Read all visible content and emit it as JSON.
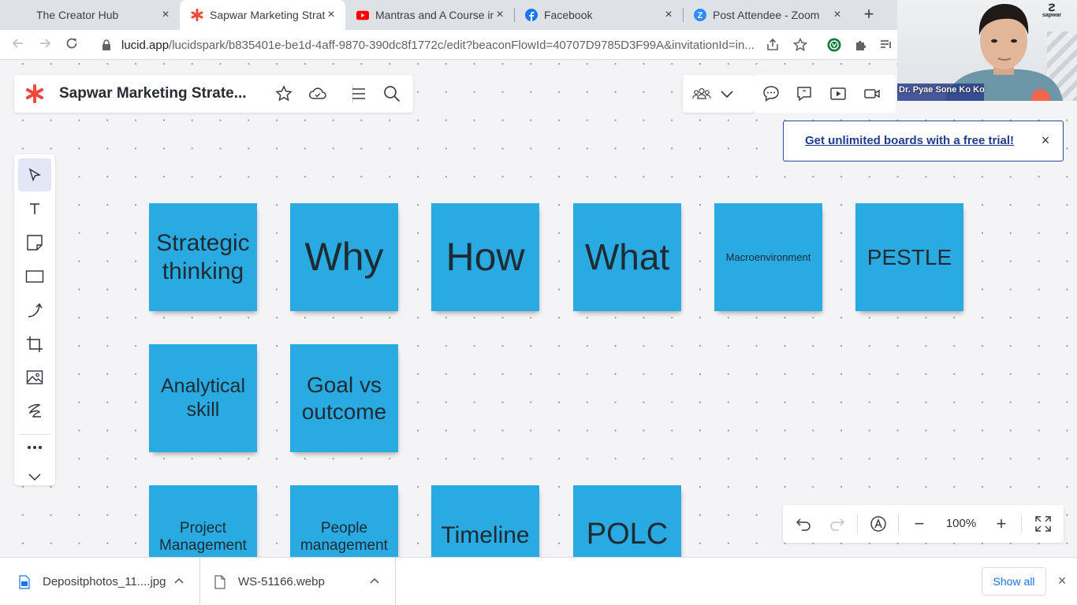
{
  "browser": {
    "tabs": [
      {
        "label": "The Creator Hub",
        "icon": "none",
        "close": "×"
      },
      {
        "label": "Sapwar Marketing Strateg",
        "icon": "lucid-asterisk-icon",
        "close": "×"
      },
      {
        "label": "Mantras and A Course in",
        "icon": "youtube-icon",
        "close": "×"
      },
      {
        "label": "Facebook",
        "icon": "facebook-icon",
        "close": "×"
      },
      {
        "label": "Post Attendee - Zoom",
        "icon": "zoom-icon",
        "close": "×"
      }
    ],
    "new_tab": "+",
    "url_domain": "lucid.app",
    "url_path": "/lucidspark/b835401e-be1d-4aff-9870-390dc8f1772c/edit?beaconFlowId=40707D9785D3F99A&invitationId=in..."
  },
  "app": {
    "doc_title": "Sapwar Marketing Strate...",
    "brand_color": "#f2483b",
    "accent_color": "#29abe2"
  },
  "trial_banner": {
    "text": "Get unlimited boards with a free trial!",
    "close": "×"
  },
  "video": {
    "participant_name": "Dr. Pyae Sone Ko Ko",
    "brand_text": "sapwar"
  },
  "notes": [
    {
      "text": "Strategic thinking",
      "font_size": 30
    },
    {
      "text": "Why",
      "font_size": 50
    },
    {
      "text": "How",
      "font_size": 50
    },
    {
      "text": "What",
      "font_size": 46
    },
    {
      "text": "Macroenvironment",
      "font_size": 13
    },
    {
      "text": "PESTLE",
      "font_size": 28
    },
    {
      "text": "Analytical skill",
      "font_size": 25
    },
    {
      "text": "Goal vs outcome",
      "font_size": 28
    },
    {
      "text": "Project Management",
      "font_size": 19
    },
    {
      "text": "People management",
      "font_size": 19
    },
    {
      "text": "Timeline",
      "font_size": 30
    },
    {
      "text": "POLC",
      "font_size": 38
    }
  ],
  "zoom": {
    "level": "100%",
    "minus": "−",
    "plus": "+"
  },
  "downloads": {
    "items": [
      {
        "name": "Depositphotos_11....jpg"
      },
      {
        "name": "WS-51166.webp"
      }
    ],
    "show_all": "Show all",
    "close": "×"
  }
}
